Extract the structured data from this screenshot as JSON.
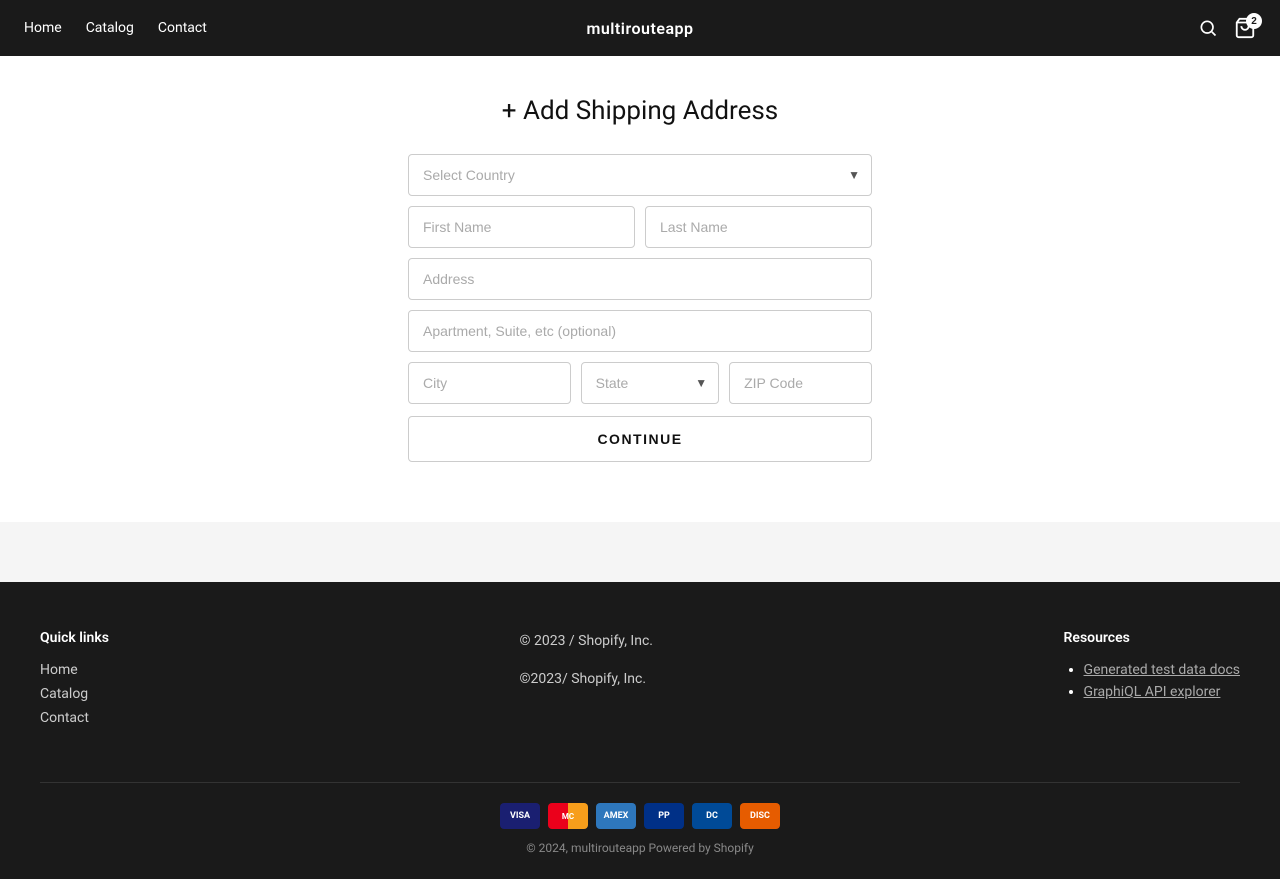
{
  "nav": {
    "brand": "multirouteapp",
    "links": [
      {
        "label": "Home",
        "href": "#"
      },
      {
        "label": "Catalog",
        "href": "#"
      },
      {
        "label": "Contact",
        "href": "#"
      }
    ],
    "cart_count": "2"
  },
  "form": {
    "title": "+ Add Shipping Address",
    "country_placeholder": "Select Country",
    "first_name_placeholder": "First Name",
    "last_name_placeholder": "Last Name",
    "address_placeholder": "Address",
    "apt_placeholder": "Apartment, Suite, etc (optional)",
    "city_placeholder": "City",
    "state_placeholder": "State",
    "zip_placeholder": "ZIP Code",
    "continue_label": "CONTINUE"
  },
  "footer": {
    "quick_links_title": "Quick links",
    "quick_links": [
      {
        "label": "Home",
        "href": "#"
      },
      {
        "label": "Catalog",
        "href": "#"
      },
      {
        "label": "Contact",
        "href": "#"
      }
    ],
    "copyright": "© 2023 / Shopify, Inc.",
    "copyright2": "©2023/ Shopify, Inc.",
    "resources_title": "Resources",
    "resources": [
      {
        "label": "Generated test data docs",
        "href": "#"
      },
      {
        "label": "GraphiQL API explorer",
        "href": "#"
      }
    ],
    "bottom_copy": "© 2024, multirouteapp Powered by Shopify",
    "payment_methods": [
      {
        "name": "Visa",
        "class": "pay-visa"
      },
      {
        "name": "MC",
        "class": "pay-mc"
      },
      {
        "name": "AMEX",
        "class": "pay-amex"
      },
      {
        "name": "PP",
        "class": "pay-paypal"
      },
      {
        "name": "DC",
        "class": "pay-diners"
      },
      {
        "name": "DISC",
        "class": "pay-discover"
      }
    ]
  }
}
